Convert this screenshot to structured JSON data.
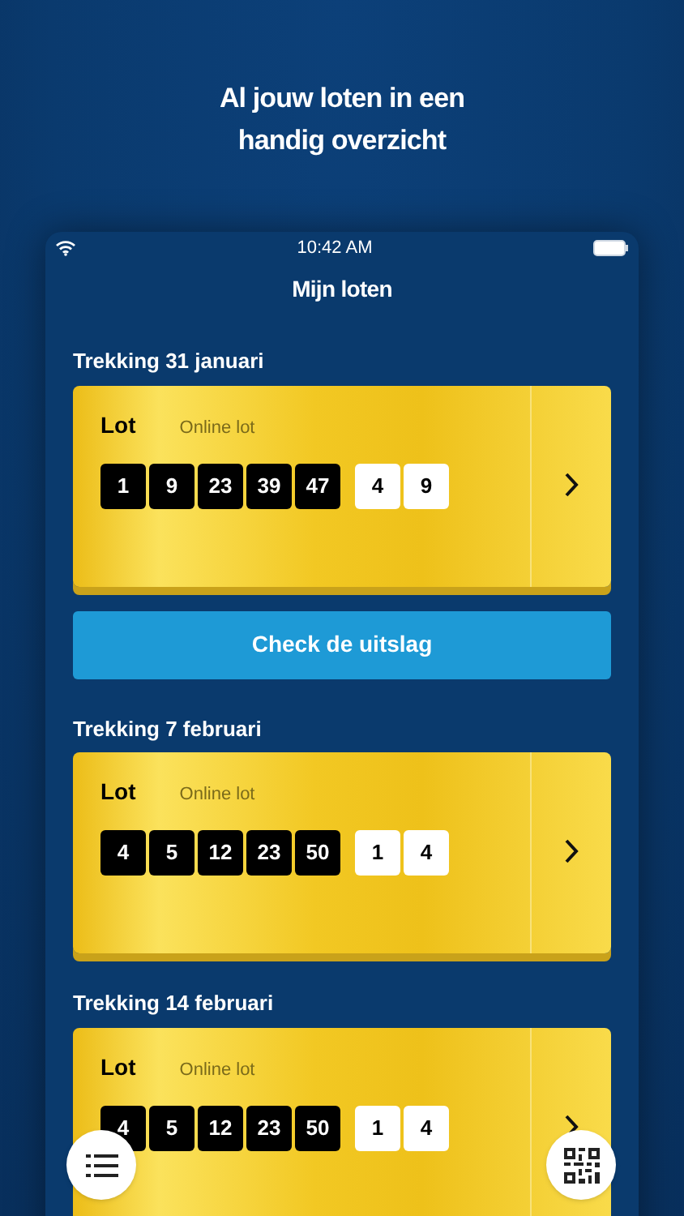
{
  "headline_lines": [
    "Al jouw loten in een",
    "handig overzicht"
  ],
  "status_bar": {
    "time": "10:42 AM"
  },
  "screen_title": "Mijn loten",
  "draws": [
    {
      "date_label": "Trekking 31 januari",
      "ticket": {
        "label": "Lot",
        "type": "Online lot",
        "numbers": [
          "1",
          "9",
          "23",
          "39",
          "47"
        ],
        "bonus_numbers": [
          "4",
          "9"
        ]
      },
      "check_button": "Check de uitslag"
    },
    {
      "date_label": "Trekking 7 februari",
      "ticket": {
        "label": "Lot",
        "type": "Online lot",
        "numbers": [
          "4",
          "5",
          "12",
          "23",
          "50"
        ],
        "bonus_numbers": [
          "1",
          "4"
        ]
      }
    },
    {
      "date_label": "Trekking 14 februari",
      "ticket": {
        "label": "Lot",
        "type": "Online lot",
        "numbers": [
          "4",
          "5",
          "12",
          "23",
          "50"
        ],
        "bonus_numbers": [
          "1",
          "4"
        ]
      }
    }
  ]
}
